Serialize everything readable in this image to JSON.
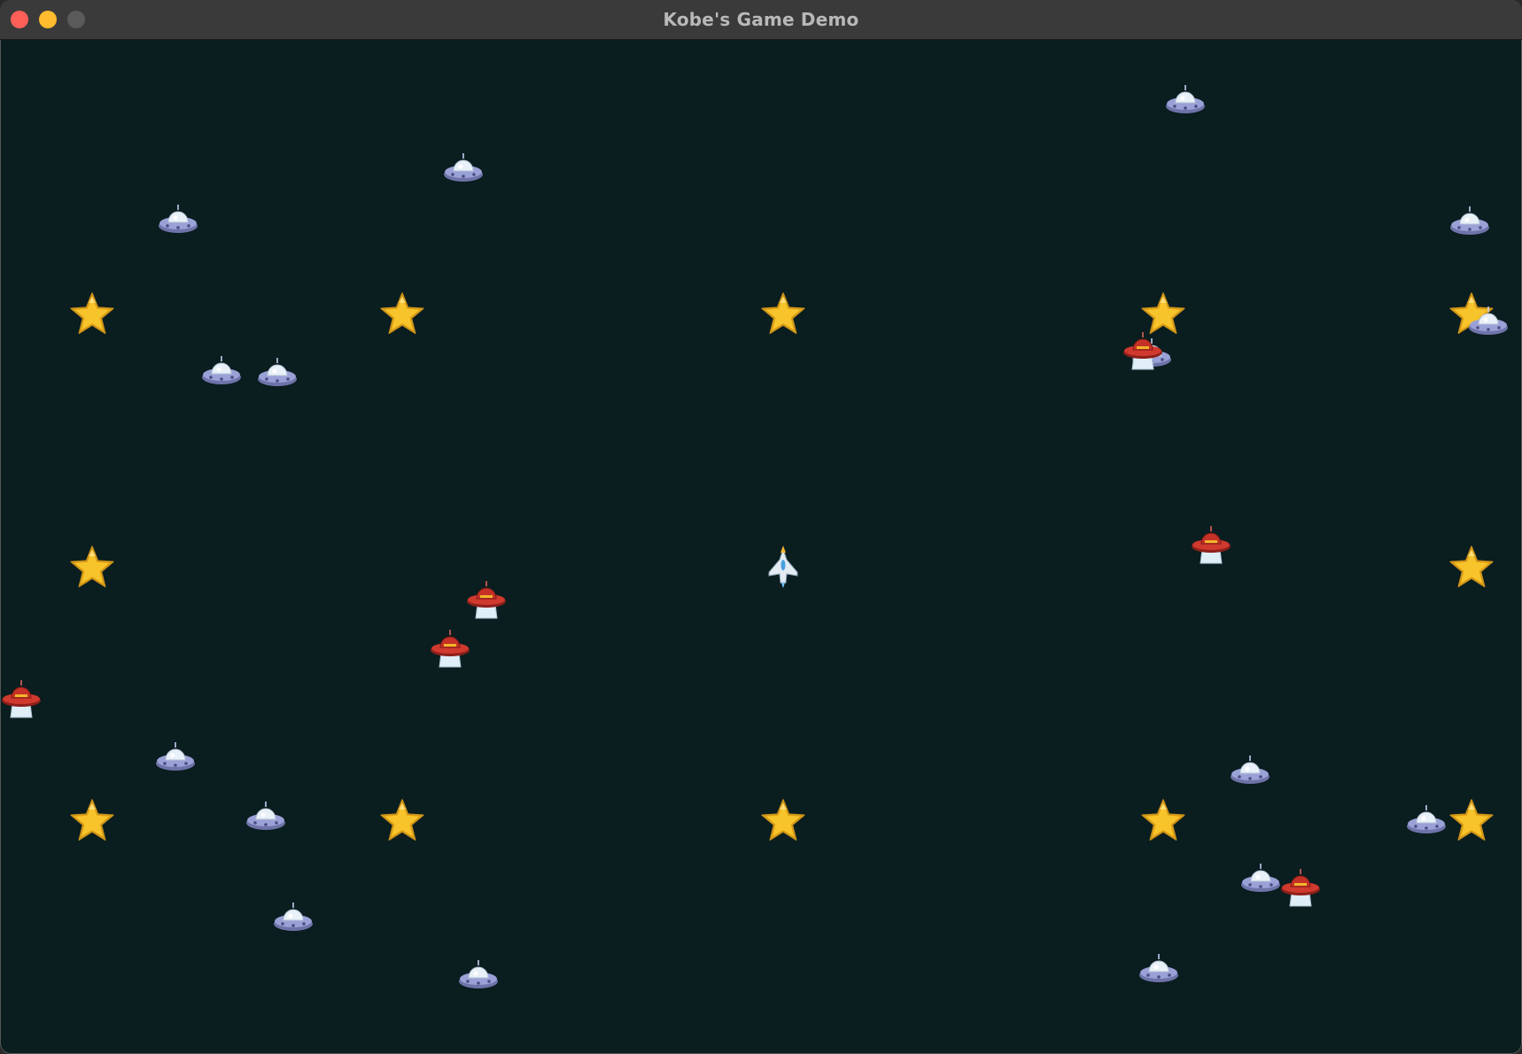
{
  "window": {
    "title": "Kobe's Game Demo"
  },
  "colors": {
    "background": "#0a1d1f",
    "star": "#f7c52b",
    "ufo_blue": "#9aa1d6",
    "ufo_red": "#d0392e"
  },
  "sprites": {
    "player": "spaceship-icon",
    "star": "star-icon",
    "ufo_blue": "ufo-icon",
    "ufo_red": "red-ufo-icon"
  }
}
